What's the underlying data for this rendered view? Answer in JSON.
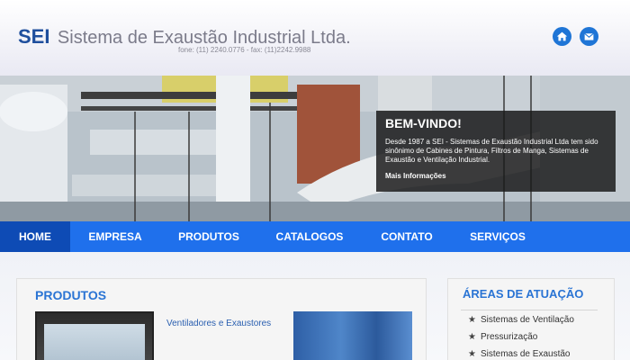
{
  "header": {
    "logo_short": "SEI",
    "logo_name": "Sistema de Exaustão Industrial Ltda.",
    "contact": "fone: (11) 2240.0776 - fax: (11)2242.9988",
    "home_icon": "home-icon",
    "mail_icon": "mail-icon"
  },
  "banner": {
    "title": "BEM-VINDO!",
    "text": "Desde 1987 a SEI - Sistemas de Exaustão Industrial Ltda tem sido sinônimo de Cabines de Pintura, Filtros de Manga, Sistemas de Exaustão e Ventilação Industrial.",
    "link": "Mais Informações"
  },
  "nav": {
    "items": [
      "HOME",
      "EMPRESA",
      "PRODUTOS",
      "CATALOGOS",
      "CONTATO",
      "SERVIÇOS"
    ],
    "active": "HOME"
  },
  "produtos": {
    "title": "PRODUTOS",
    "item1": "Ventiladores e Exaustores"
  },
  "areas": {
    "title": "ÁREAS DE ATUAÇÃO",
    "items": [
      "Sistemas de Ventilação",
      "Pressurização",
      "Sistemas de Exaustão"
    ]
  },
  "colors": {
    "nav": "#1f70ec",
    "nav_active": "#0e4bb5",
    "accent": "#2a74d4",
    "logo": "#1f4f9d"
  }
}
